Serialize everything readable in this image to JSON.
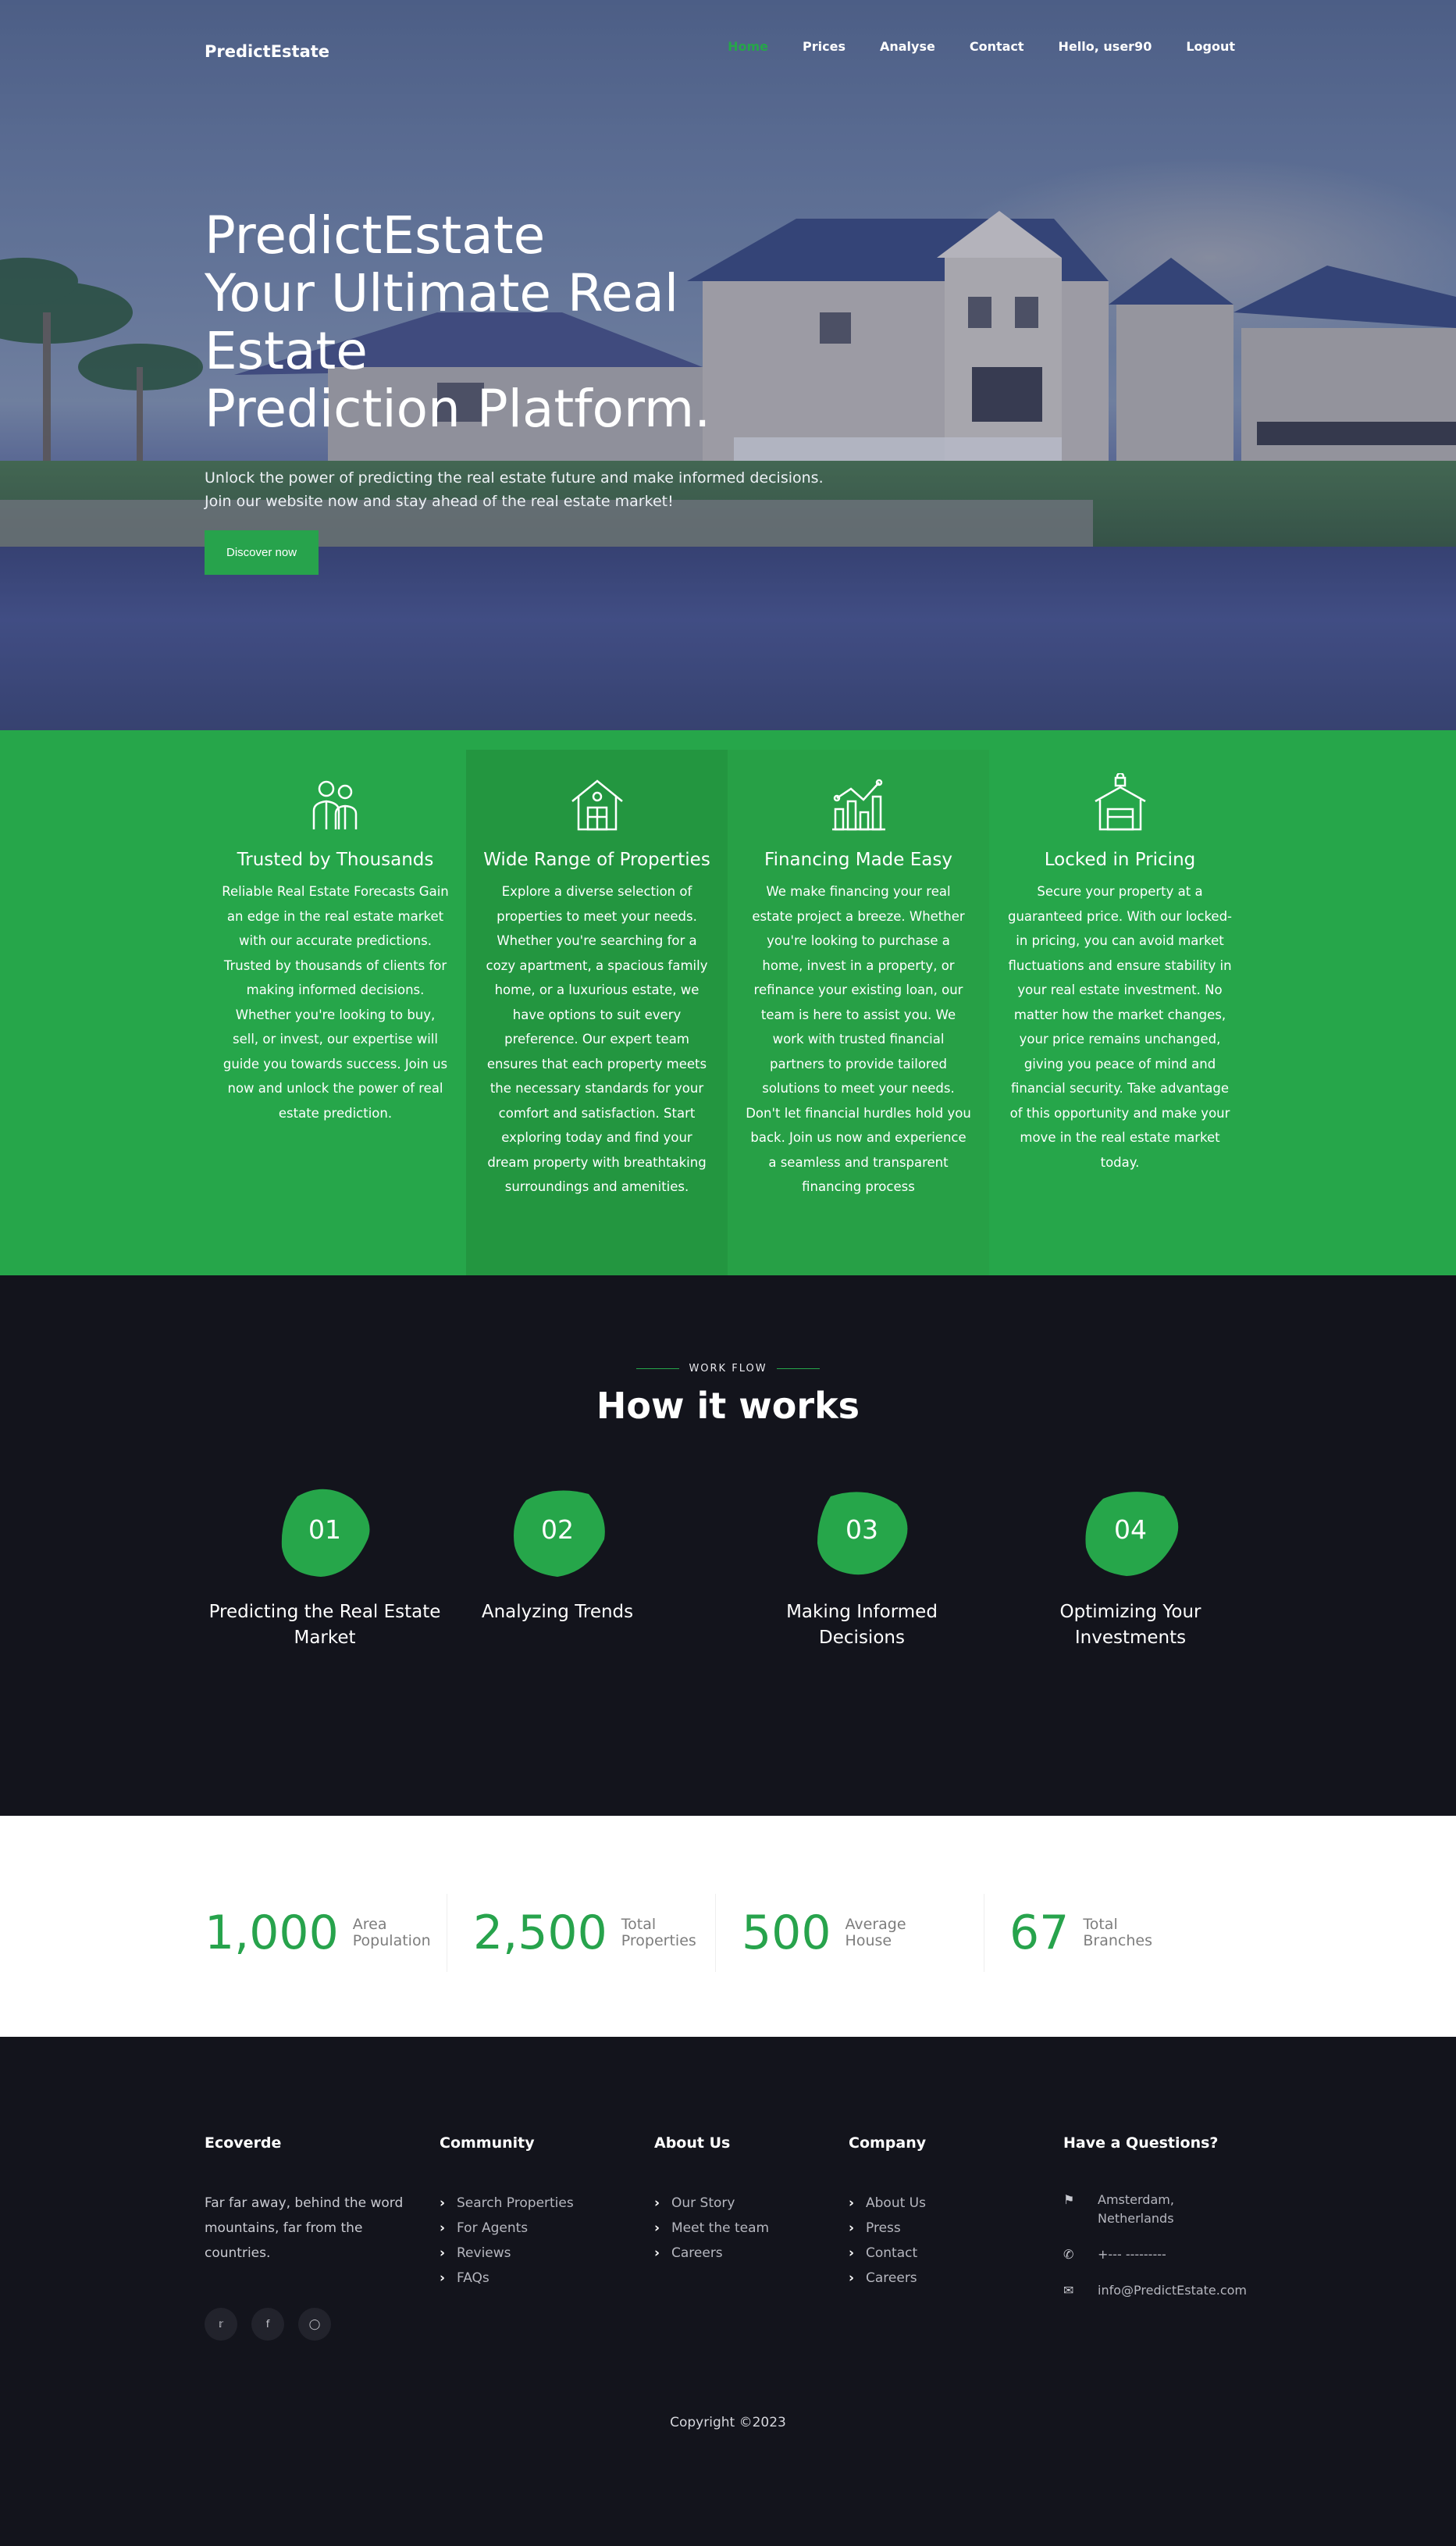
{
  "nav": {
    "brand": "PredictEstate",
    "links": [
      "Home",
      "Prices",
      "Analyse",
      "Contact",
      "Hello, user90",
      "Logout"
    ]
  },
  "hero": {
    "title_line1": "PredictEstate",
    "title_line2": "Your Ultimate Real Estate",
    "title_line3": "Prediction Platform.",
    "subtitle": "Unlock the power of predicting the real estate future and make informed decisions. Join our website now and stay ahead of the real estate market!",
    "button": "Discover now"
  },
  "features": [
    {
      "icon": "agents-icon",
      "title": "Trusted by Thousands",
      "text": "Reliable Real Estate Forecasts Gain an edge in the real estate market with our accurate predictions. Trusted by thousands of clients for making informed decisions. Whether you're looking to buy, sell, or invest, our expertise will guide you towards success. Join us now and unlock the power of real estate prediction."
    },
    {
      "icon": "house-icon",
      "title": "Wide Range of Properties",
      "text": "Explore a diverse selection of properties to meet your needs. Whether you're searching for a cozy apartment, a spacious family home, or a luxurious estate, we have options to suit every preference. Our expert team ensures that each property meets the necessary standards for your comfort and satisfaction. Start exploring today and find your dream property with breathtaking surroundings and amenities."
    },
    {
      "icon": "chart-icon",
      "title": "Financing Made Easy",
      "text": "We make financing your real estate project a breeze. Whether you're looking to purchase a home, invest in a property, or refinance your existing loan, our team is here to assist you. We work with trusted financial partners to provide tailored solutions to meet your needs. Don't let financial hurdles hold you back. Join us now and experience a seamless and transparent financing process"
    },
    {
      "icon": "locked-house-icon",
      "title": "Locked in Pricing",
      "text": "Secure your property at a guaranteed price. With our locked-in pricing, you can avoid market fluctuations and ensure stability in your real estate investment. No matter how the market changes, your price remains unchanged, giving you peace of mind and financial security. Take advantage of this opportunity and make your move in the real estate market today."
    }
  ],
  "how": {
    "eyebrow": "WORK FLOW",
    "title": "How it works",
    "steps": [
      {
        "num": "01",
        "title": "Predicting the Real Estate Market"
      },
      {
        "num": "02",
        "title": "Analyzing Trends"
      },
      {
        "num": "03",
        "title": "Making Informed Decisions"
      },
      {
        "num": "04",
        "title": "Optimizing Your Investments"
      }
    ]
  },
  "stats": [
    {
      "num": "1,000",
      "label": "Area Population"
    },
    {
      "num": "2,500",
      "label": "Total Properties"
    },
    {
      "num": "500",
      "label": "Average House"
    },
    {
      "num": "67",
      "label": "Total Branches"
    }
  ],
  "footer": {
    "brand": "Ecoverde",
    "about": "Far far away, behind the word mountains, far from the countries.",
    "community_title": "Community",
    "community": [
      "Search Properties",
      "For Agents",
      "Reviews",
      "FAQs"
    ],
    "about_title": "About Us",
    "about_links": [
      "Our Story",
      "Meet the team",
      "Careers"
    ],
    "company_title": "Company",
    "company": [
      "About Us",
      "Press",
      "Contact",
      "Careers"
    ],
    "contact_title": "Have a Questions?",
    "address": "Amsterdam, Netherlands",
    "phone": "+--- ---------",
    "email": "info@PredictEstate.com",
    "socials": [
      "twitter-icon",
      "facebook-icon",
      "instagram-icon"
    ],
    "copyright": "Copyright ©2023"
  },
  "colors": {
    "accent": "#26a64a",
    "dark": "#13141c"
  }
}
